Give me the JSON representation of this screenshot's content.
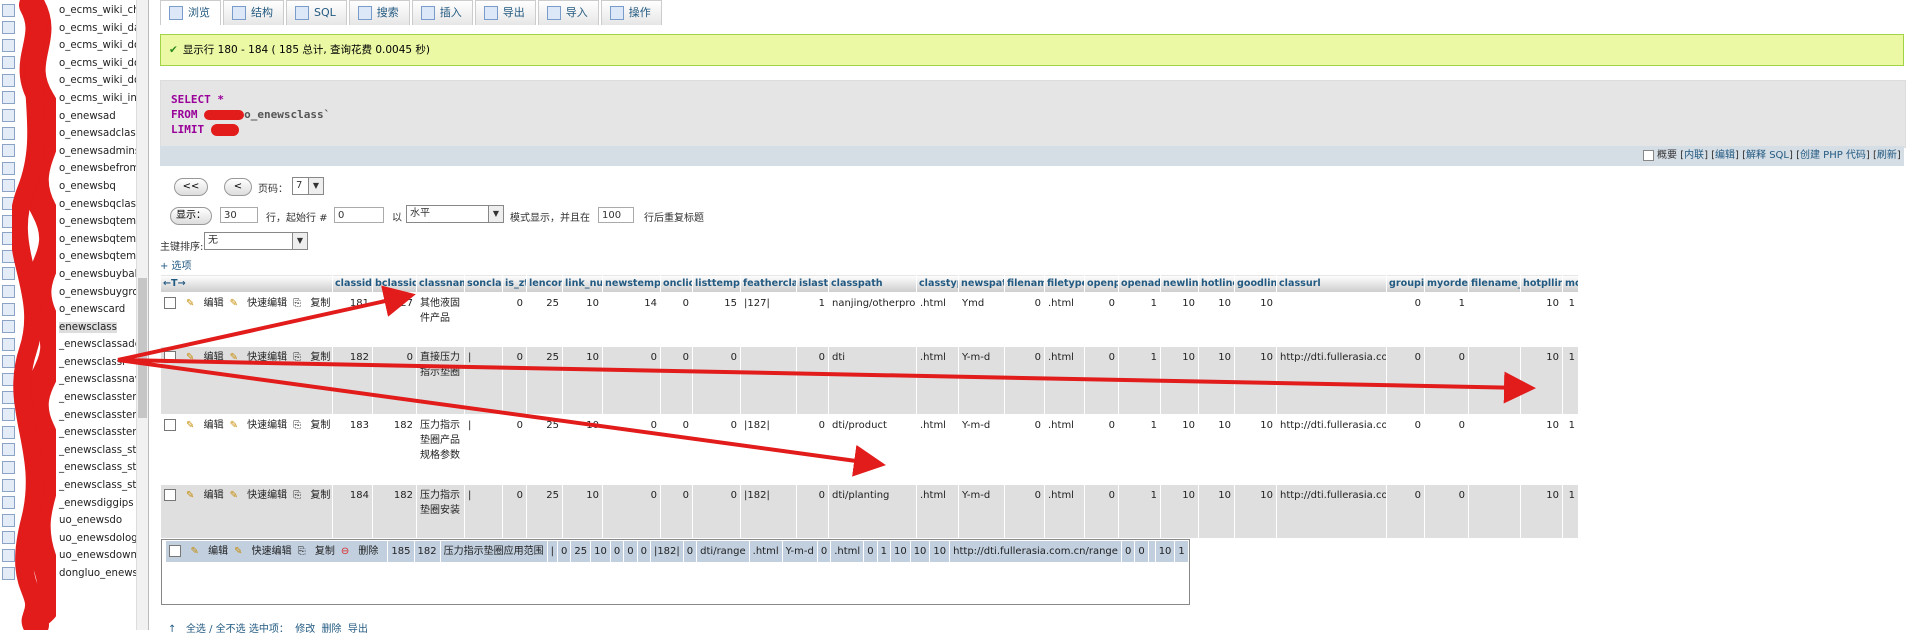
{
  "sidebar": {
    "items": [
      "o_ecms_wiki_che",
      "o_ecms_wiki_data",
      "o_ecms_wiki_doc",
      "o_ecms_wiki_doc",
      "o_ecms_wiki_doc",
      "o_ecms_wiki_inde",
      "o_enewsad",
      "o_enewsadclass",
      "o_enewsadminst",
      "o_enewsbefrom",
      "o_enewsbq",
      "o_enewsbqclass",
      "o_enewsbqtemp",
      "o_enewsbqtemp",
      "o_enewsbqtemp",
      "o_enewsbuybak",
      "o_enewsbuygrou",
      "o_enewscard",
      "enewsclass",
      "_enewsclassadd",
      "_enewsclassf",
      "_enewsclassnav",
      "_enewsclassten",
      "_enewsclassten",
      "_enewsclassten",
      "_enewsclass_sta",
      "_enewsclass_sta",
      "_enewsclass_sta",
      "_enewsdiggips",
      "uo_enewsdo",
      "uo_enewsdolog",
      "uo_enewsdowner",
      "dongluo_enewsdownrec"
    ],
    "active_index": 18
  },
  "tabs": [
    "浏览",
    "结构",
    "SQL",
    "搜索",
    "插入",
    "导出",
    "导入",
    "操作"
  ],
  "success_message": "显示行 180 - 184 ( 185 总计, 查询花费 0.0045 秒)",
  "sql": {
    "line1": "SELECT *",
    "line2_kw": "FROM",
    "line2_rest": "o_enewsclass`",
    "line3_kw": "LIMIT"
  },
  "sql_links": {
    "profile": "概要",
    "inline": "内联",
    "edit": "编辑",
    "explain": "解释 SQL",
    "php": "创建 PHP 代码",
    "refresh": "刷新"
  },
  "nav": {
    "first": "<<",
    "prev": "<",
    "page_label": "页码：",
    "page_value": "7",
    "show_button": "显示：",
    "rows_value": "30",
    "start_label": "行，起始行 #",
    "start_value": "0",
    "by_label": "以",
    "mode_value": "水平",
    "mode_suffix": "模式显示，并且在",
    "repeat_value": "100",
    "repeat_suffix": "行后重复标题",
    "sort_label": "主键排序:",
    "sort_value": "无",
    "options_link": "+ 选项"
  },
  "columns": [
    "classid",
    "bclassid",
    "classname",
    "sonclass",
    "is_zt",
    "lencord",
    "link_num",
    "newstempid",
    "onclick",
    "listtempid",
    "featherclass",
    "islast",
    "classpath",
    "classtype",
    "newspath",
    "filename",
    "filetype",
    "openpl",
    "openadd",
    "newline",
    "hotline",
    "goodline",
    "classurl",
    "groupid",
    "myorder",
    "filename_qz",
    "hotplline",
    "modid"
  ],
  "row_ops": {
    "edit": "编辑",
    "quick_edit": "快速编辑",
    "copy": "复制",
    "delete": "删除"
  },
  "rows": [
    [
      "181",
      "127",
      "其他液固件产品",
      "",
      "0",
      "25",
      "10",
      "14",
      "0",
      "15",
      "|127|",
      "1",
      "nanjing/otherproduct",
      ".html",
      "Ymd",
      "0",
      ".html",
      "0",
      "1",
      "10",
      "10",
      "10",
      "",
      "0",
      "1",
      "",
      "10",
      "1"
    ],
    [
      "182",
      "0",
      "直接压力指示垫圈",
      "|",
      "0",
      "25",
      "10",
      "0",
      "0",
      "0",
      "",
      "0",
      "dti",
      ".html",
      "Y-m-d",
      "0",
      ".html",
      "0",
      "1",
      "10",
      "10",
      "10",
      "http://dti.fullerasia.com.cn",
      "0",
      "0",
      "",
      "10",
      "1"
    ],
    [
      "183",
      "182",
      "压力指示垫圈产品规格参数",
      "|",
      "0",
      "25",
      "10",
      "0",
      "0",
      "0",
      "|182|",
      "0",
      "dti/product",
      ".html",
      "Y-m-d",
      "0",
      ".html",
      "0",
      "1",
      "10",
      "10",
      "10",
      "http://dti.fullerasia.com.cn/product",
      "0",
      "0",
      "",
      "10",
      "1"
    ],
    [
      "184",
      "182",
      "压力指示垫圈安装",
      "|",
      "0",
      "25",
      "10",
      "0",
      "0",
      "0",
      "|182|",
      "0",
      "dti/planting",
      ".html",
      "Y-m-d",
      "0",
      ".html",
      "0",
      "1",
      "10",
      "10",
      "10",
      "http://dti.fullerasia.com.cn/planting",
      "0",
      "0",
      "",
      "10",
      "1"
    ],
    [
      "185",
      "182",
      "压力指示垫圈应用范围",
      "|",
      "0",
      "25",
      "10",
      "0",
      "0",
      "0",
      "|182|",
      "0",
      "dti/range",
      ".html",
      "Y-m-d",
      "0",
      ".html",
      "0",
      "1",
      "10",
      "10",
      "10",
      "http://dti.fullerasia.com.cn/range",
      "0",
      "0",
      "",
      "10",
      "1"
    ]
  ],
  "footer": {
    "check_all": "全选 / 全不选 选中项：",
    "change": "修改",
    "delete": "删除",
    "export": "导出"
  },
  "colors": {
    "accent": "#235a81",
    "success_bg": "#ebf8a4",
    "annotation": "#e21b1b"
  }
}
